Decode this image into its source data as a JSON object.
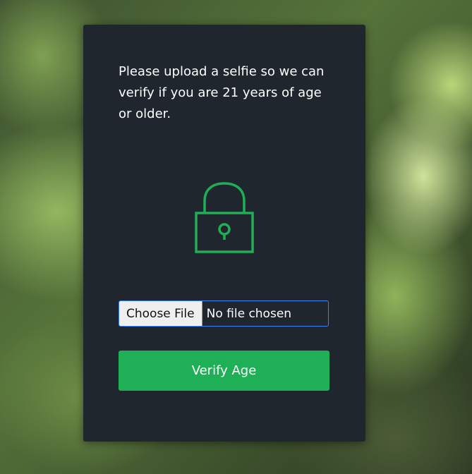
{
  "card": {
    "message": "Please upload a selfie so we can verify if you are 21 years of age or older.",
    "icon": "lock-icon"
  },
  "file_input": {
    "button_label": "Choose File",
    "status": "No file chosen"
  },
  "verify_button": {
    "label": "Verify Age"
  },
  "colors": {
    "card_bg": "#1f262d",
    "accent_green": "#1faf57",
    "icon_green": "#1fae56",
    "focus_blue": "#3b82f6",
    "text": "#ffffff"
  }
}
